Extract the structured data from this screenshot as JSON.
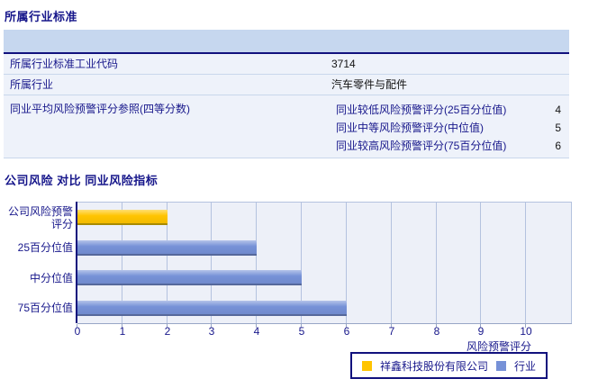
{
  "section1": {
    "title": "所属行业标准",
    "table": {
      "rows": [
        {
          "label": "所属行业标准工业代码",
          "value": "3714"
        },
        {
          "label": "所属行业",
          "value": "汽车零件与配件"
        },
        {
          "label": "同业平均风险预警评分参照(四等分数)",
          "sub_rows": [
            {
              "label": "同业较低风险预警评分(25百分位值)",
              "value": "4"
            },
            {
              "label": "同业中等风险预警评分(中位值)",
              "value": "5"
            },
            {
              "label": "同业较高风险预警评分(75百分位值)",
              "value": "6"
            }
          ]
        }
      ]
    }
  },
  "section2": {
    "title": "公司风险 对比 同业风险指标"
  },
  "colors": {
    "accent_navy": "#11117d",
    "table_header_bg": "#c6d7ef",
    "company_bar": "#ffc400",
    "industry_bar": "#7691d7"
  },
  "chart_data": {
    "type": "bar",
    "orientation": "horizontal",
    "title": "公司风险 对比 同业风险指标",
    "categories": [
      "公司风险预警评分",
      "25百分位值",
      "中分位值",
      "75百分位值"
    ],
    "values": [
      2,
      4,
      5,
      6
    ],
    "bar_colors": [
      "#ffc400",
      "#7691d7",
      "#7691d7",
      "#7691d7"
    ],
    "bar_edge_colors": [
      "#a88a00",
      "#55689b",
      "#55689b",
      "#55689b"
    ],
    "bar_series": [
      "祥鑫科技股份有限公司",
      "行业",
      "行业",
      "行业"
    ],
    "xlabel": "风险预警评分",
    "ylabel": "",
    "xlim": [
      0,
      11
    ],
    "xticks": [
      0,
      1,
      2,
      3,
      4,
      5,
      6,
      7,
      8,
      9,
      10
    ],
    "grid": "vertical",
    "plot_bg": "#edf0f8",
    "legend_position": "bottom",
    "legend": [
      {
        "label": "祥鑫科技股份有限公司",
        "color": "#ffc400"
      },
      {
        "label": "行业",
        "color": "#7691d7"
      }
    ]
  }
}
